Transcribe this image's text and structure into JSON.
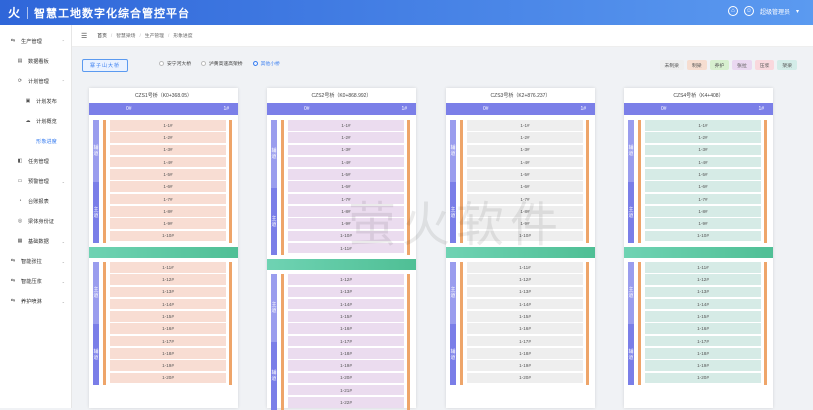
{
  "header": {
    "title": "智慧工地数字化综合管控平台",
    "logo_glyph": "⽕",
    "home_icon": "⌂",
    "user_icon": "☺",
    "user": "超级管理员",
    "user_caret": "▾"
  },
  "sidebar": {
    "items": [
      {
        "label": "生产管理",
        "icon": "⇆",
        "level": 1,
        "arrow": "⌃"
      },
      {
        "label": "数据看板",
        "icon": "▤",
        "level": 2
      },
      {
        "label": "计划管理",
        "icon": "⟳",
        "level": 2,
        "arrow": "⌃"
      },
      {
        "label": "计划发布",
        "icon": "▣",
        "level": 3
      },
      {
        "label": "计划概览",
        "icon": "☁",
        "level": 3
      },
      {
        "label": "形象进度",
        "icon": "",
        "level": 3,
        "active": true
      },
      {
        "label": "任务管理",
        "icon": "◧",
        "level": 2
      },
      {
        "label": "预警管理",
        "icon": "▭",
        "level": 2,
        "arrow": "⌄"
      },
      {
        "label": "台账报表",
        "icon": "◔",
        "level": 2
      },
      {
        "label": "梁体身份证",
        "icon": "◎",
        "level": 2
      },
      {
        "label": "基础数据",
        "icon": "▦",
        "level": 2,
        "arrow": "⌄"
      },
      {
        "label": "智能张拉",
        "icon": "⇆",
        "level": 1,
        "arrow": "⌄"
      },
      {
        "label": "智能压浆",
        "icon": "⇆",
        "level": 1,
        "arrow": "⌄"
      },
      {
        "label": "养护喷淋",
        "icon": "⇆",
        "level": 1,
        "arrow": "⌄"
      }
    ]
  },
  "breadcrumb": {
    "menu_icon": "☰",
    "items": [
      "首页",
      "智慧梁场",
      "生产管理",
      "形象进度"
    ],
    "separator": "/"
  },
  "filter": {
    "button": "寨子山大桥",
    "radios": [
      {
        "label": "安宁河大桥",
        "on": false
      },
      {
        "label": "泸黄高速高架桥",
        "on": false
      },
      {
        "label": "其他小桥",
        "on": true
      }
    ]
  },
  "legend": [
    {
      "label": "未制梁",
      "color": "#eeeeee"
    },
    {
      "label": "制梁",
      "color": "#f6ddd0"
    },
    {
      "label": "养护",
      "color": "#d7efcf"
    },
    {
      "label": "张拉",
      "color": "#ead8f1"
    },
    {
      "label": "压浆",
      "color": "#f9d8dd"
    },
    {
      "label": "架梁",
      "color": "#d3ece8"
    }
  ],
  "colors": {
    "header_bar": "#7b7fe8",
    "divider": "#5fcaa5",
    "pier_bar": "#eea56a"
  },
  "cards": [
    {
      "title": "CZS1号桥（K0+368.05）",
      "left": "0#",
      "right": "1#",
      "cell_color": "#f8ddd3",
      "top_label": "辅 道",
      "top_label2": "主 道",
      "top": [
        "1-1#",
        "1-2#",
        "1-3#",
        "1-4#",
        "1-5#",
        "1-6#",
        "1-7#",
        "1-8#",
        "1-9#",
        "1-10#"
      ],
      "bottom_label": "主 道",
      "bottom_label2": "辅 道",
      "bottom": [
        "1-11#",
        "1-12#",
        "1-13#",
        "1-14#",
        "1-15#",
        "1-16#",
        "1-17#",
        "1-18#",
        "1-19#",
        "1-20#"
      ]
    },
    {
      "title": "CZS2号桥（K0+868.992）",
      "left": "0#",
      "right": "1#",
      "cell_color": "#ebdcef",
      "top_label": "辅 道",
      "top_label2": "主 道",
      "top": [
        "1-1#",
        "1-2#",
        "1-3#",
        "1-4#",
        "1-5#",
        "1-6#",
        "1-7#",
        "1-8#",
        "1-9#",
        "1-10#",
        "1-11#"
      ],
      "bottom_label": "主 道",
      "bottom_label2": "辅 道",
      "bottom": [
        "1-12#",
        "1-13#",
        "1-14#",
        "1-15#",
        "1-16#",
        "1-17#",
        "1-18#",
        "1-19#",
        "1-20#",
        "1-21#",
        "1-22#"
      ]
    },
    {
      "title": "CZS3号桥（K2+876.237）",
      "left": "0#",
      "right": "1#",
      "cell_color": "#eeeeee",
      "top_label": "辅 道",
      "top_label2": "主 道",
      "top": [
        "1-1#",
        "1-2#",
        "1-3#",
        "1-4#",
        "1-5#",
        "1-6#",
        "1-7#",
        "1-8#",
        "1-9#",
        "1-10#"
      ],
      "bottom_label": "主 道",
      "bottom_label2": "辅 道",
      "bottom": [
        "1-11#",
        "1-12#",
        "1-13#",
        "1-14#",
        "1-15#",
        "1-16#",
        "1-17#",
        "1-18#",
        "1-19#",
        "1-20#"
      ]
    },
    {
      "title": "CZS4号桥（K4+408）",
      "left": "0#",
      "right": "1#",
      "cell_color": "#d6ebe6",
      "top_label": "辅 道",
      "top_label2": "主 道",
      "top": [
        "1-1#",
        "1-2#",
        "1-3#",
        "1-4#",
        "1-5#",
        "1-6#",
        "1-7#",
        "1-8#",
        "1-9#",
        "1-10#"
      ],
      "bottom_label": "主 道",
      "bottom_label2": "辅 道",
      "bottom": [
        "1-11#",
        "1-12#",
        "1-13#",
        "1-14#",
        "1-15#",
        "1-16#",
        "1-17#",
        "1-18#",
        "1-19#",
        "1-20#"
      ]
    }
  ],
  "watermark": "萤火软件"
}
